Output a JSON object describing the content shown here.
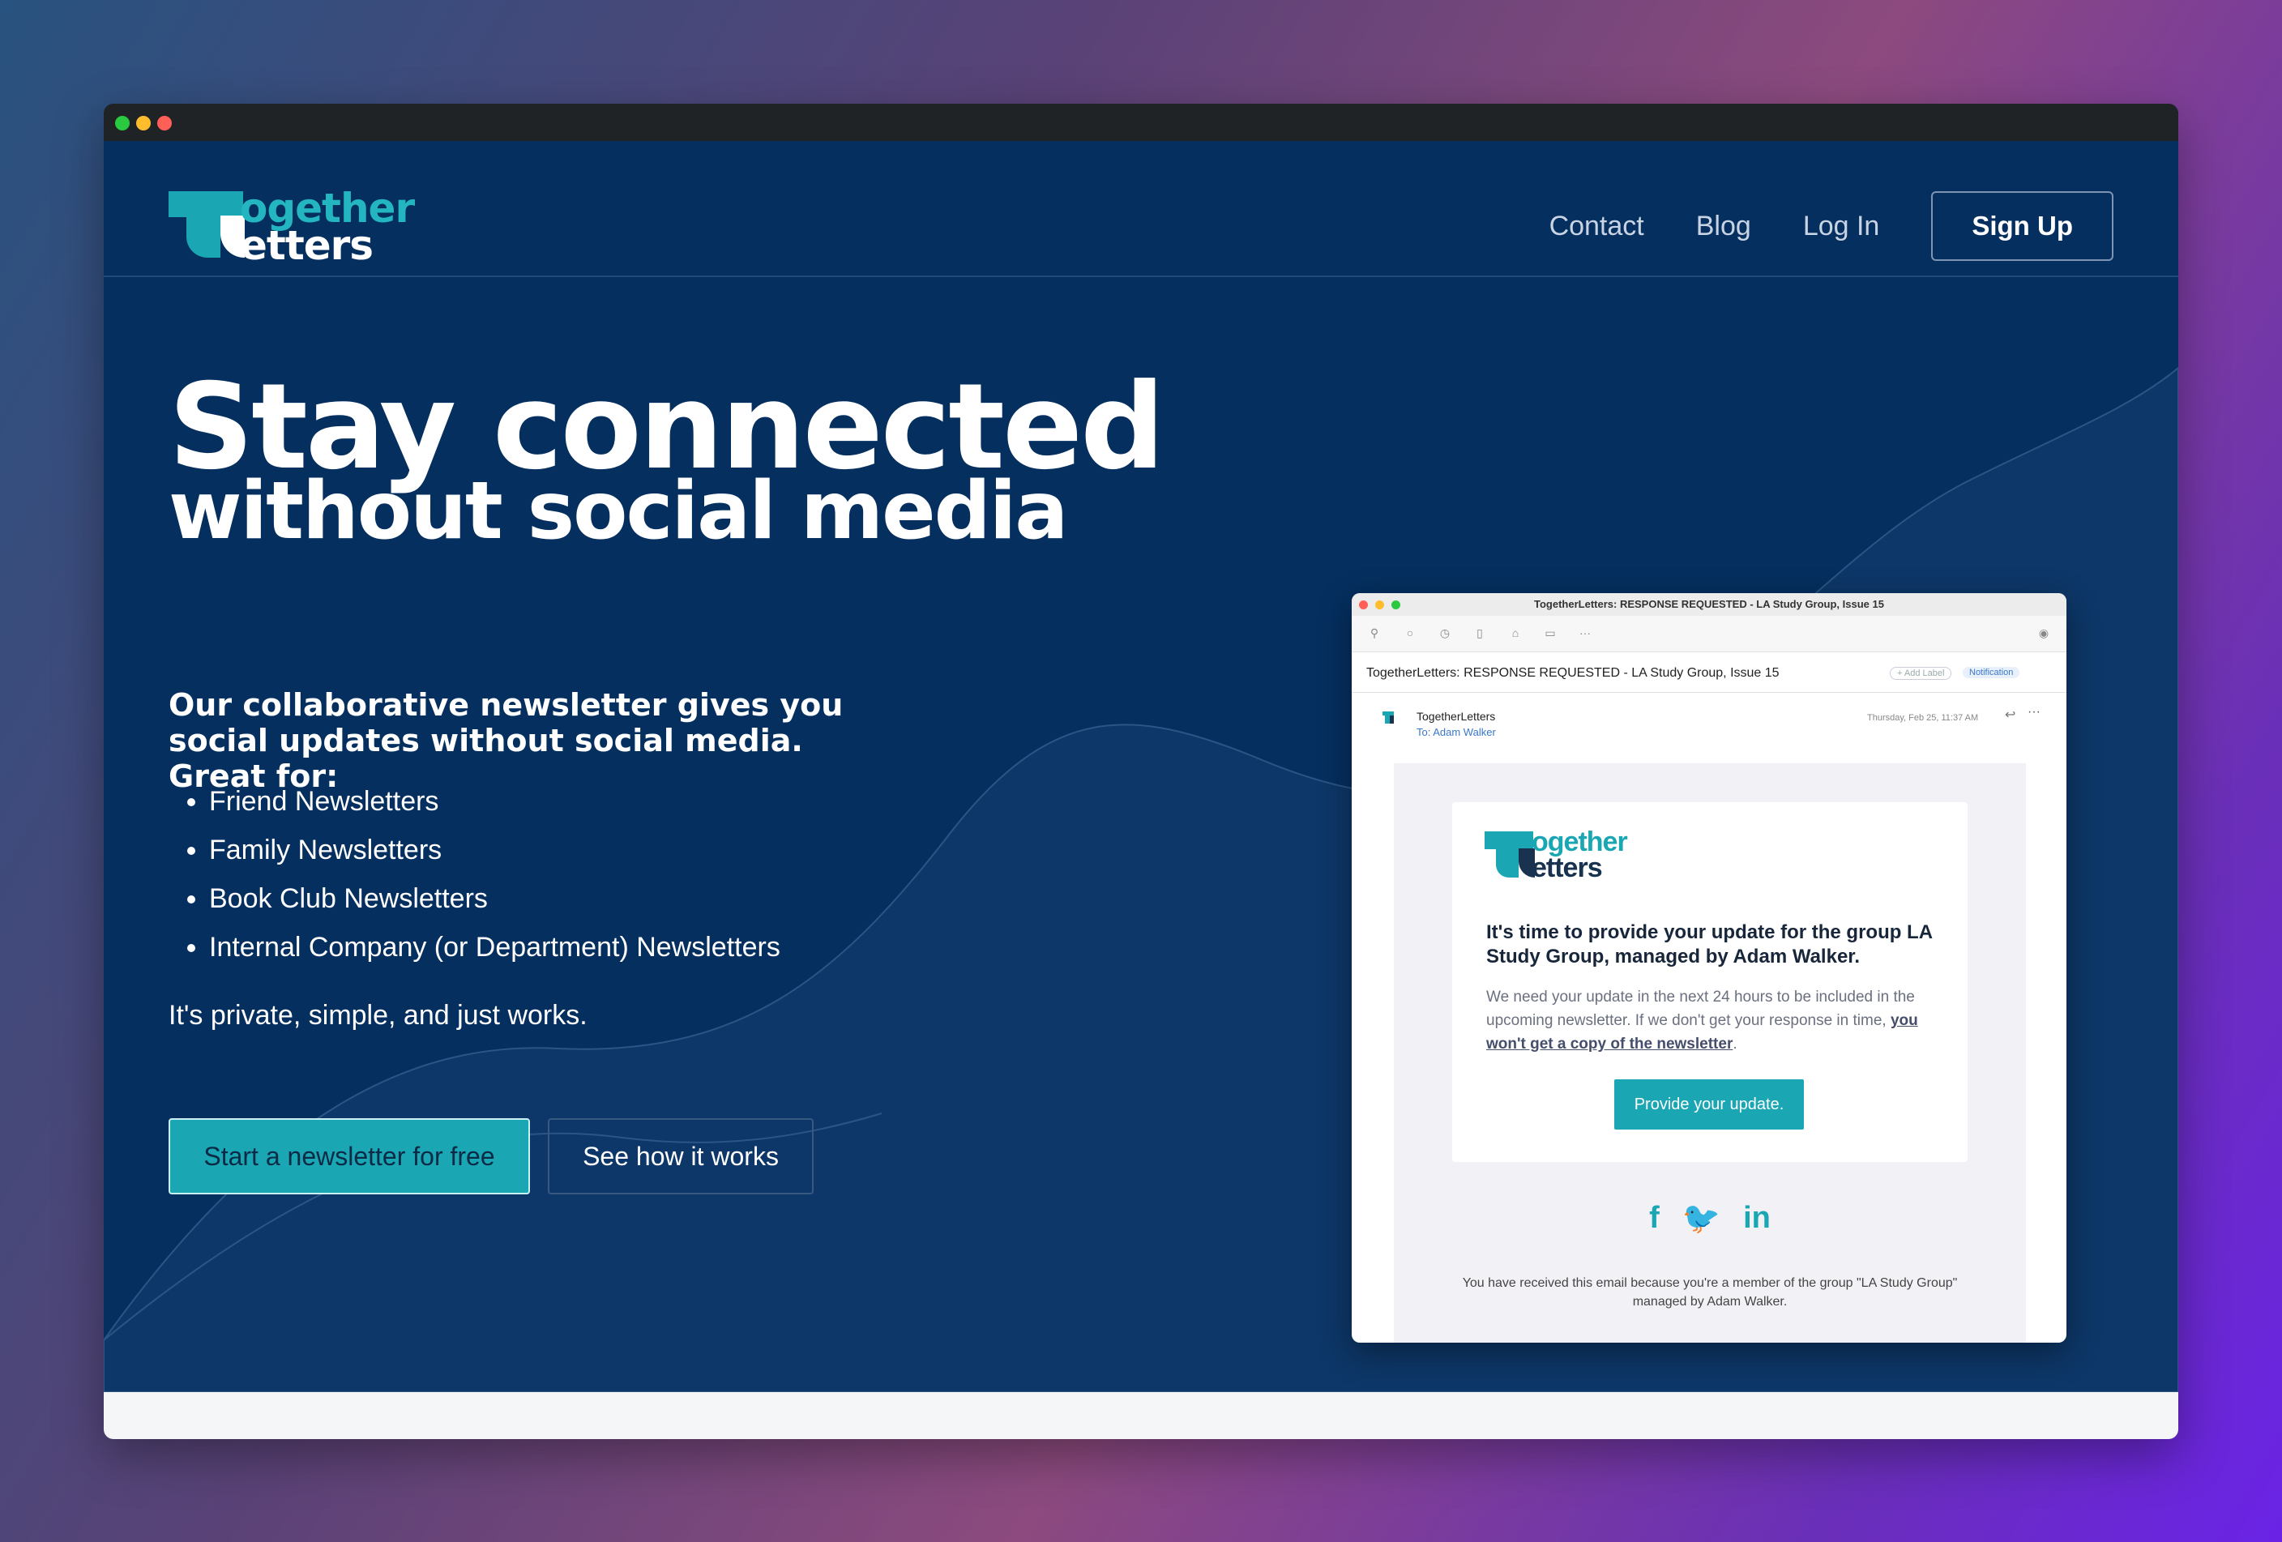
{
  "brand": {
    "logo_line1": "ogether",
    "logo_line2": "etters"
  },
  "nav": {
    "contact": "Contact",
    "blog": "Blog",
    "login": "Log In",
    "signup": "Sign Up"
  },
  "hero": {
    "title": "Stay connected",
    "subtitle": "without social media",
    "lead": "Our collaborative newsletter gives you social updates without social media. Great for:",
    "uses": [
      "Friend Newsletters",
      "Family Newsletters",
      "Book Club Newsletters",
      "Internal Company (or Department) Newsletters"
    ],
    "tagline": "It's private, simple, and just works.",
    "primary_cta": "Start a newsletter for free",
    "secondary_cta": "See how it works"
  },
  "email": {
    "window_title": "TogetherLetters: RESPONSE REQUESTED - LA Study Group, Issue 15",
    "subject": "TogetherLetters: RESPONSE REQUESTED - LA Study Group, Issue 15",
    "add_label": "+ Add Label",
    "notification": "Notification",
    "sender": "TogetherLetters",
    "to": "To: Adam Walker",
    "date": "Thursday, Feb 25, 11:37 AM",
    "logo_line1": "ogether",
    "logo_line2": "etters",
    "heading": "It's time to provide your update for the group LA Study Group, managed by Adam Walker.",
    "body_text": "We need your update in the next 24 hours to be included in the upcoming newsletter. If we don't get your response in time,",
    "body_link": "you won't get a copy of the newsletter",
    "body_end": ".",
    "button": "Provide your update.",
    "social": {
      "facebook": "f",
      "twitter": "🐦",
      "linkedin": "in"
    },
    "footer": "You have received this email because you're a member of the group \"LA Study Group\" managed by Adam Walker."
  },
  "colors": {
    "navy": "#052f5f",
    "teal": "#1aa6b3",
    "white": "#ffffff"
  },
  "icons": [
    "window-close-icon",
    "window-minimize-icon",
    "window-maximize-icon",
    "pin-icon",
    "circle-icon",
    "clock-icon",
    "trash-icon",
    "inbox-icon",
    "folder-icon",
    "more-icon",
    "reply-icon",
    "facebook-icon",
    "twitter-icon",
    "linkedin-icon"
  ]
}
